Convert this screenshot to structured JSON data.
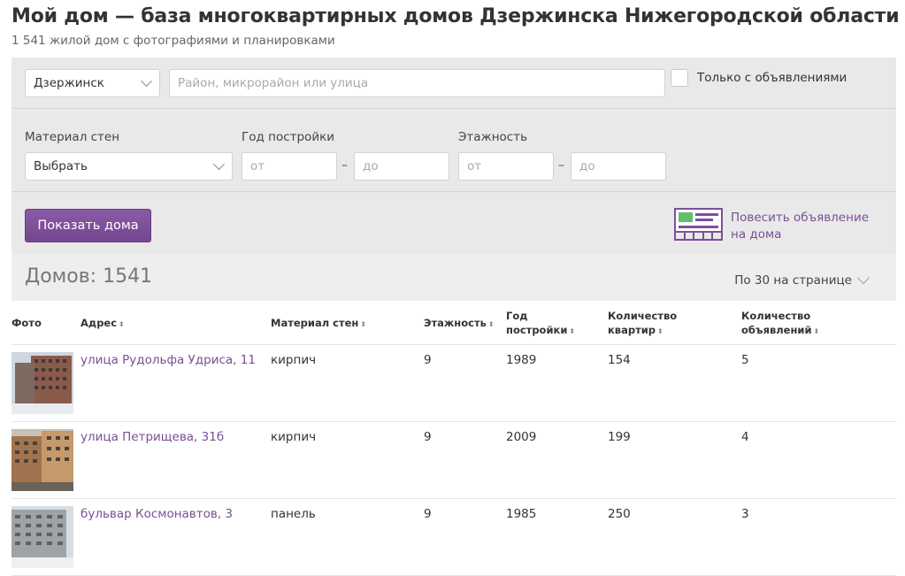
{
  "header": {
    "title": "Мой дом — база многоквартирных домов Дзержинска Нижегородской области",
    "subtitle": "1 541 жилой дом с фотографиями и планировками"
  },
  "filters": {
    "city_value": "Дзержинск",
    "search_placeholder": "Район, микрорайон или улица",
    "only_with_ads_label": "Только с объявлениями",
    "material_label": "Материал стен",
    "material_value": "Выбрать",
    "year_label": "Год постройки",
    "floors_label": "Этажность",
    "from_placeholder": "от",
    "to_placeholder": "до",
    "range_dash": "–",
    "show_button": "Показать дома",
    "promo_line1": "Повесить объявление",
    "promo_line2": "на дома"
  },
  "results": {
    "count_label": "Домов: 1541",
    "per_page_label": "По 30 на странице"
  },
  "table": {
    "headers": {
      "photo": "Фото",
      "address": "Адрес",
      "material": "Материал стен",
      "floors": "Этажность",
      "year_1": "Год",
      "year_2": "постройки",
      "apts_1": "Количество",
      "apts_2": "квартир",
      "ads_1": "Количество",
      "ads_2": "объявлений"
    },
    "rows": [
      {
        "address": "улица Рудольфа Удриса, 11",
        "material": "кирпич",
        "floors": "9",
        "year": "1989",
        "apartments": "154",
        "ads": "5"
      },
      {
        "address": "улица Петрищева, 31б",
        "material": "кирпич",
        "floors": "9",
        "year": "2009",
        "apartments": "199",
        "ads": "4"
      },
      {
        "address": "бульвар Космонавтов, 3",
        "material": "панель",
        "floors": "9",
        "year": "1985",
        "apartments": "250",
        "ads": "3"
      }
    ]
  },
  "colors": {
    "accent": "#7e4f9a",
    "link": "#7a4f95",
    "filter_bg": "#e9e9e9",
    "promo_icon": "#7e4f9a",
    "promo_icon_green": "#5fbf6a"
  }
}
